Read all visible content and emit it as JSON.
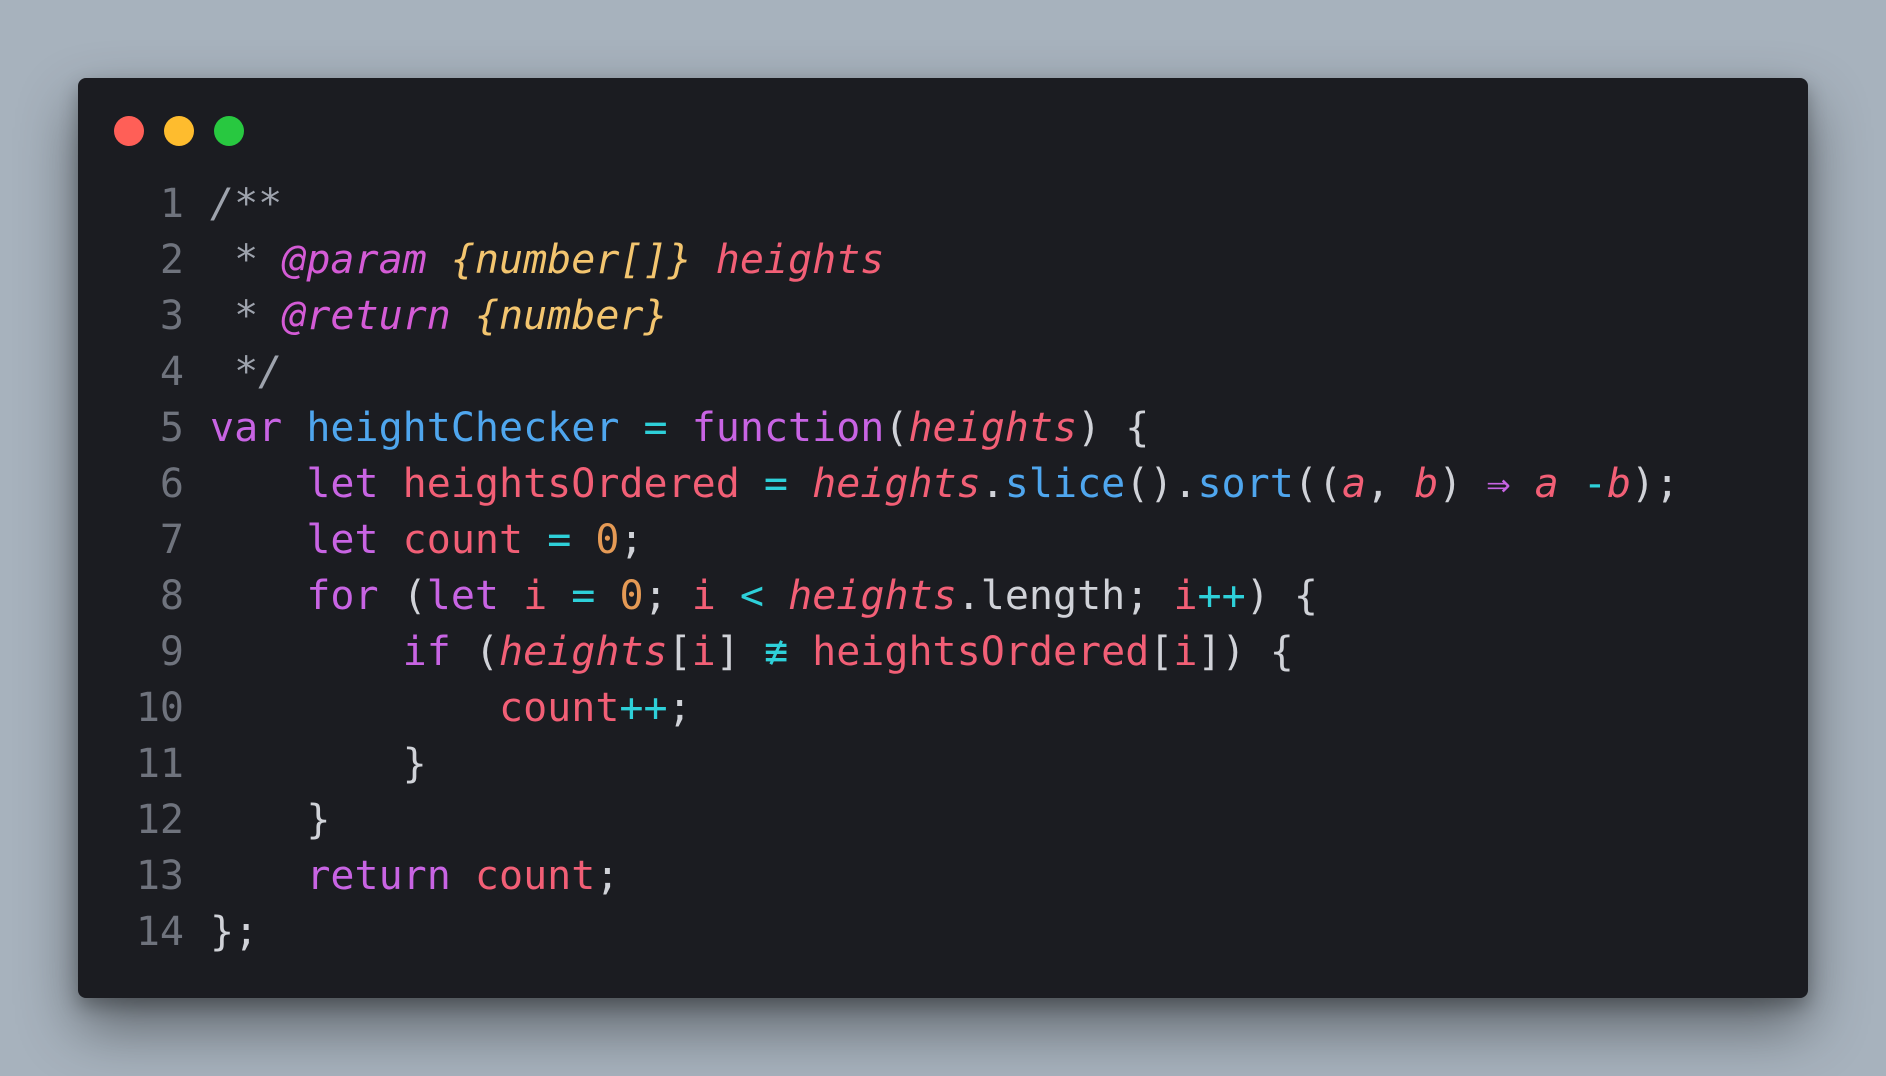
{
  "colors": {
    "background": "#a7b2bd",
    "window": "#1b1c21",
    "dot_red": "#ff5f57",
    "dot_yellow": "#febc2e",
    "dot_green": "#28c840",
    "comment": "#9ea3ad",
    "tag": "#d45bd6",
    "type": "#f3c56f",
    "param": "#f25f76",
    "keyword": "#c864e3",
    "function": "#4fa6ee",
    "operator": "#2ed0d9",
    "number": "#e59a55",
    "punct": "#d0d2d8",
    "variable": "#f25f76",
    "property": "#d0d2d8"
  },
  "code": {
    "lines": [
      {
        "no": "1",
        "tokens": [
          {
            "t": "/**",
            "c": "comment",
            "i": true
          }
        ]
      },
      {
        "no": "2",
        "tokens": [
          {
            "t": " * ",
            "c": "comment",
            "i": true
          },
          {
            "t": "@param",
            "c": "tag",
            "i": true
          },
          {
            "t": " ",
            "c": "comment",
            "i": true
          },
          {
            "t": "{number[]}",
            "c": "type",
            "i": true
          },
          {
            "t": " ",
            "c": "comment",
            "i": true
          },
          {
            "t": "heights",
            "c": "param",
            "i": true
          }
        ]
      },
      {
        "no": "3",
        "tokens": [
          {
            "t": " * ",
            "c": "comment",
            "i": true
          },
          {
            "t": "@return",
            "c": "tag",
            "i": true
          },
          {
            "t": " ",
            "c": "comment",
            "i": true
          },
          {
            "t": "{number}",
            "c": "type",
            "i": true
          }
        ]
      },
      {
        "no": "4",
        "tokens": [
          {
            "t": " */",
            "c": "comment",
            "i": true
          }
        ]
      },
      {
        "no": "5",
        "tokens": [
          {
            "t": "var",
            "c": "keyword"
          },
          {
            "t": " ",
            "c": "punct"
          },
          {
            "t": "heightChecker",
            "c": "function"
          },
          {
            "t": " ",
            "c": "punct"
          },
          {
            "t": "=",
            "c": "operator"
          },
          {
            "t": " ",
            "c": "punct"
          },
          {
            "t": "function",
            "c": "keyword"
          },
          {
            "t": "(",
            "c": "punct"
          },
          {
            "t": "heights",
            "c": "param",
            "i": true
          },
          {
            "t": ") {",
            "c": "punct"
          }
        ]
      },
      {
        "no": "6",
        "tokens": [
          {
            "t": "    ",
            "c": "punct"
          },
          {
            "t": "let",
            "c": "keyword"
          },
          {
            "t": " ",
            "c": "punct"
          },
          {
            "t": "heightsOrdered",
            "c": "variable"
          },
          {
            "t": " ",
            "c": "punct"
          },
          {
            "t": "=",
            "c": "operator"
          },
          {
            "t": " ",
            "c": "punct"
          },
          {
            "t": "heights",
            "c": "param",
            "i": true
          },
          {
            "t": ".",
            "c": "punct"
          },
          {
            "t": "slice",
            "c": "function"
          },
          {
            "t": "().",
            "c": "punct"
          },
          {
            "t": "sort",
            "c": "function"
          },
          {
            "t": "((",
            "c": "punct"
          },
          {
            "t": "a",
            "c": "param",
            "i": true
          },
          {
            "t": ", ",
            "c": "punct"
          },
          {
            "t": "b",
            "c": "param",
            "i": true
          },
          {
            "t": ") ",
            "c": "punct"
          },
          {
            "t": "⇒",
            "c": "keyword"
          },
          {
            "t": " ",
            "c": "punct"
          },
          {
            "t": "a",
            "c": "param",
            "i": true
          },
          {
            "t": " ",
            "c": "punct"
          },
          {
            "t": "-",
            "c": "operator"
          },
          {
            "t": "b",
            "c": "param",
            "i": true
          },
          {
            "t": ");",
            "c": "punct"
          }
        ]
      },
      {
        "no": "7",
        "tokens": [
          {
            "t": "    ",
            "c": "punct"
          },
          {
            "t": "let",
            "c": "keyword"
          },
          {
            "t": " ",
            "c": "punct"
          },
          {
            "t": "count",
            "c": "variable"
          },
          {
            "t": " ",
            "c": "punct"
          },
          {
            "t": "=",
            "c": "operator"
          },
          {
            "t": " ",
            "c": "punct"
          },
          {
            "t": "0",
            "c": "number"
          },
          {
            "t": ";",
            "c": "punct"
          }
        ]
      },
      {
        "no": "8",
        "tokens": [
          {
            "t": "    ",
            "c": "punct"
          },
          {
            "t": "for",
            "c": "keyword"
          },
          {
            "t": " (",
            "c": "punct"
          },
          {
            "t": "let",
            "c": "keyword"
          },
          {
            "t": " ",
            "c": "punct"
          },
          {
            "t": "i",
            "c": "variable"
          },
          {
            "t": " ",
            "c": "punct"
          },
          {
            "t": "=",
            "c": "operator"
          },
          {
            "t": " ",
            "c": "punct"
          },
          {
            "t": "0",
            "c": "number"
          },
          {
            "t": "; ",
            "c": "punct"
          },
          {
            "t": "i",
            "c": "variable"
          },
          {
            "t": " ",
            "c": "punct"
          },
          {
            "t": "<",
            "c": "operator"
          },
          {
            "t": " ",
            "c": "punct"
          },
          {
            "t": "heights",
            "c": "param",
            "i": true
          },
          {
            "t": ".length; ",
            "c": "property"
          },
          {
            "t": "i",
            "c": "variable"
          },
          {
            "t": "++",
            "c": "operator"
          },
          {
            "t": ") {",
            "c": "punct"
          }
        ]
      },
      {
        "no": "9",
        "tokens": [
          {
            "t": "        ",
            "c": "punct"
          },
          {
            "t": "if",
            "c": "keyword"
          },
          {
            "t": " (",
            "c": "punct"
          },
          {
            "t": "heights",
            "c": "param",
            "i": true
          },
          {
            "t": "[",
            "c": "punct"
          },
          {
            "t": "i",
            "c": "variable"
          },
          {
            "t": "] ",
            "c": "punct"
          },
          {
            "t": "≢",
            "c": "operator"
          },
          {
            "t": " ",
            "c": "punct"
          },
          {
            "t": "heightsOrdered",
            "c": "variable"
          },
          {
            "t": "[",
            "c": "punct"
          },
          {
            "t": "i",
            "c": "variable"
          },
          {
            "t": "]) {",
            "c": "punct"
          }
        ]
      },
      {
        "no": "10",
        "tokens": [
          {
            "t": "            ",
            "c": "punct"
          },
          {
            "t": "count",
            "c": "variable"
          },
          {
            "t": "++",
            "c": "operator"
          },
          {
            "t": ";",
            "c": "punct"
          }
        ]
      },
      {
        "no": "11",
        "tokens": [
          {
            "t": "        }",
            "c": "punct"
          }
        ]
      },
      {
        "no": "12",
        "tokens": [
          {
            "t": "    }",
            "c": "punct"
          }
        ]
      },
      {
        "no": "13",
        "tokens": [
          {
            "t": "    ",
            "c": "punct"
          },
          {
            "t": "return",
            "c": "keyword"
          },
          {
            "t": " ",
            "c": "punct"
          },
          {
            "t": "count",
            "c": "variable"
          },
          {
            "t": ";",
            "c": "punct"
          }
        ]
      },
      {
        "no": "14",
        "tokens": [
          {
            "t": "};",
            "c": "punct"
          }
        ]
      }
    ]
  }
}
